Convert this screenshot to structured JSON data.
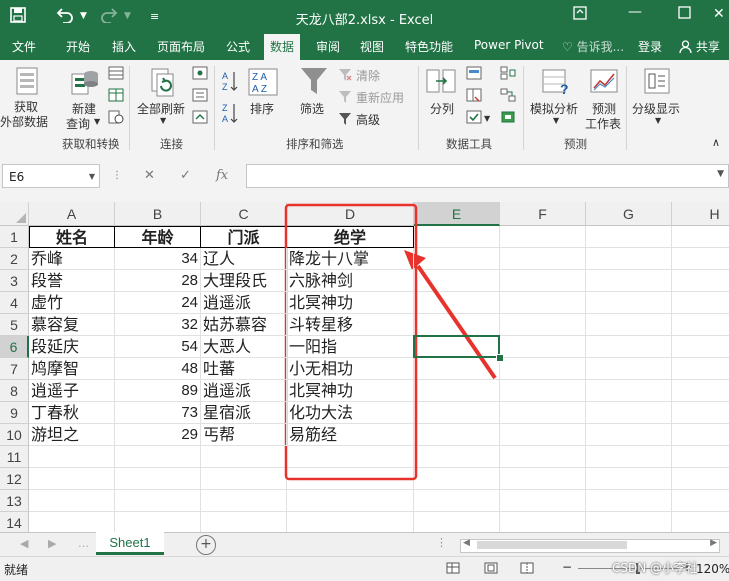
{
  "window": {
    "title": "天龙八部2.xlsx - Excel",
    "colors": {
      "brand": "#217346",
      "annotation": "#e8322c"
    }
  },
  "tabs": [
    {
      "label": "文件"
    },
    {
      "label": "开始"
    },
    {
      "label": "插入"
    },
    {
      "label": "页面布局"
    },
    {
      "label": "公式"
    },
    {
      "label": "数据",
      "active": true
    },
    {
      "label": "审阅"
    },
    {
      "label": "视图"
    },
    {
      "label": "特色功能"
    },
    {
      "label": "Power Pivot"
    }
  ],
  "tell_me": "♡ 告诉我...",
  "signin": "登录",
  "share": "共享",
  "ribbon": {
    "get_external_line1": "获取",
    "get_external_line2": "外部数据",
    "new_query_line1": "新建",
    "new_query_line2": "查询",
    "refresh_all": "全部刷新",
    "sort": "排序",
    "filter": "筛选",
    "clear": "清除",
    "reapply": "重新应用",
    "advanced": "高级",
    "text_to_columns": "分列",
    "what_if": "模拟分析",
    "forecast_line1": "预测",
    "forecast_line2": "工作表",
    "outline": "分级显示",
    "groups": {
      "get_transform": "获取和转换",
      "connections": "连接",
      "sort_filter": "排序和筛选",
      "data_tools": "数据工具",
      "forecast": "预测"
    }
  },
  "formula_bar": {
    "name_box": "E6",
    "fx": "fx",
    "value": ""
  },
  "sheet": {
    "columns": [
      "A",
      "B",
      "C",
      "D",
      "E",
      "F",
      "G",
      "H"
    ],
    "selected_column": "E",
    "selected_row": "6",
    "row_numbers": [
      "1",
      "2",
      "3",
      "4",
      "5",
      "6",
      "7",
      "8",
      "9",
      "10",
      "11",
      "12",
      "13",
      "14"
    ],
    "headers": [
      "姓名",
      "年龄",
      "门派",
      "绝学"
    ],
    "rows": [
      {
        "name": "乔峰",
        "age": "34",
        "sect": "辽人",
        "skill": "降龙十八掌"
      },
      {
        "name": "段誉",
        "age": "28",
        "sect": "大理段氏",
        "skill": "六脉神剑"
      },
      {
        "name": "虚竹",
        "age": "24",
        "sect": "逍遥派",
        "skill": "北冥神功"
      },
      {
        "name": "慕容复",
        "age": "32",
        "sect": "姑苏慕容",
        "skill": "斗转星移"
      },
      {
        "name": "段延庆",
        "age": "54",
        "sect": "大恶人",
        "skill": "一阳指"
      },
      {
        "name": "鸠摩智",
        "age": "48",
        "sect": "吐蕃",
        "skill": "小无相功"
      },
      {
        "name": "逍遥子",
        "age": "89",
        "sect": "逍遥派",
        "skill": "北冥神功"
      },
      {
        "name": "丁春秋",
        "age": "73",
        "sect": "星宿派",
        "skill": "化功大法"
      },
      {
        "name": "游坦之",
        "age": "29",
        "sect": "丐帮",
        "skill": "易筋经"
      }
    ]
  },
  "sheet_tab": "Sheet1",
  "status": {
    "ready": "就绪",
    "zoom": "120%",
    "watermark": "CSDN @小李社"
  }
}
